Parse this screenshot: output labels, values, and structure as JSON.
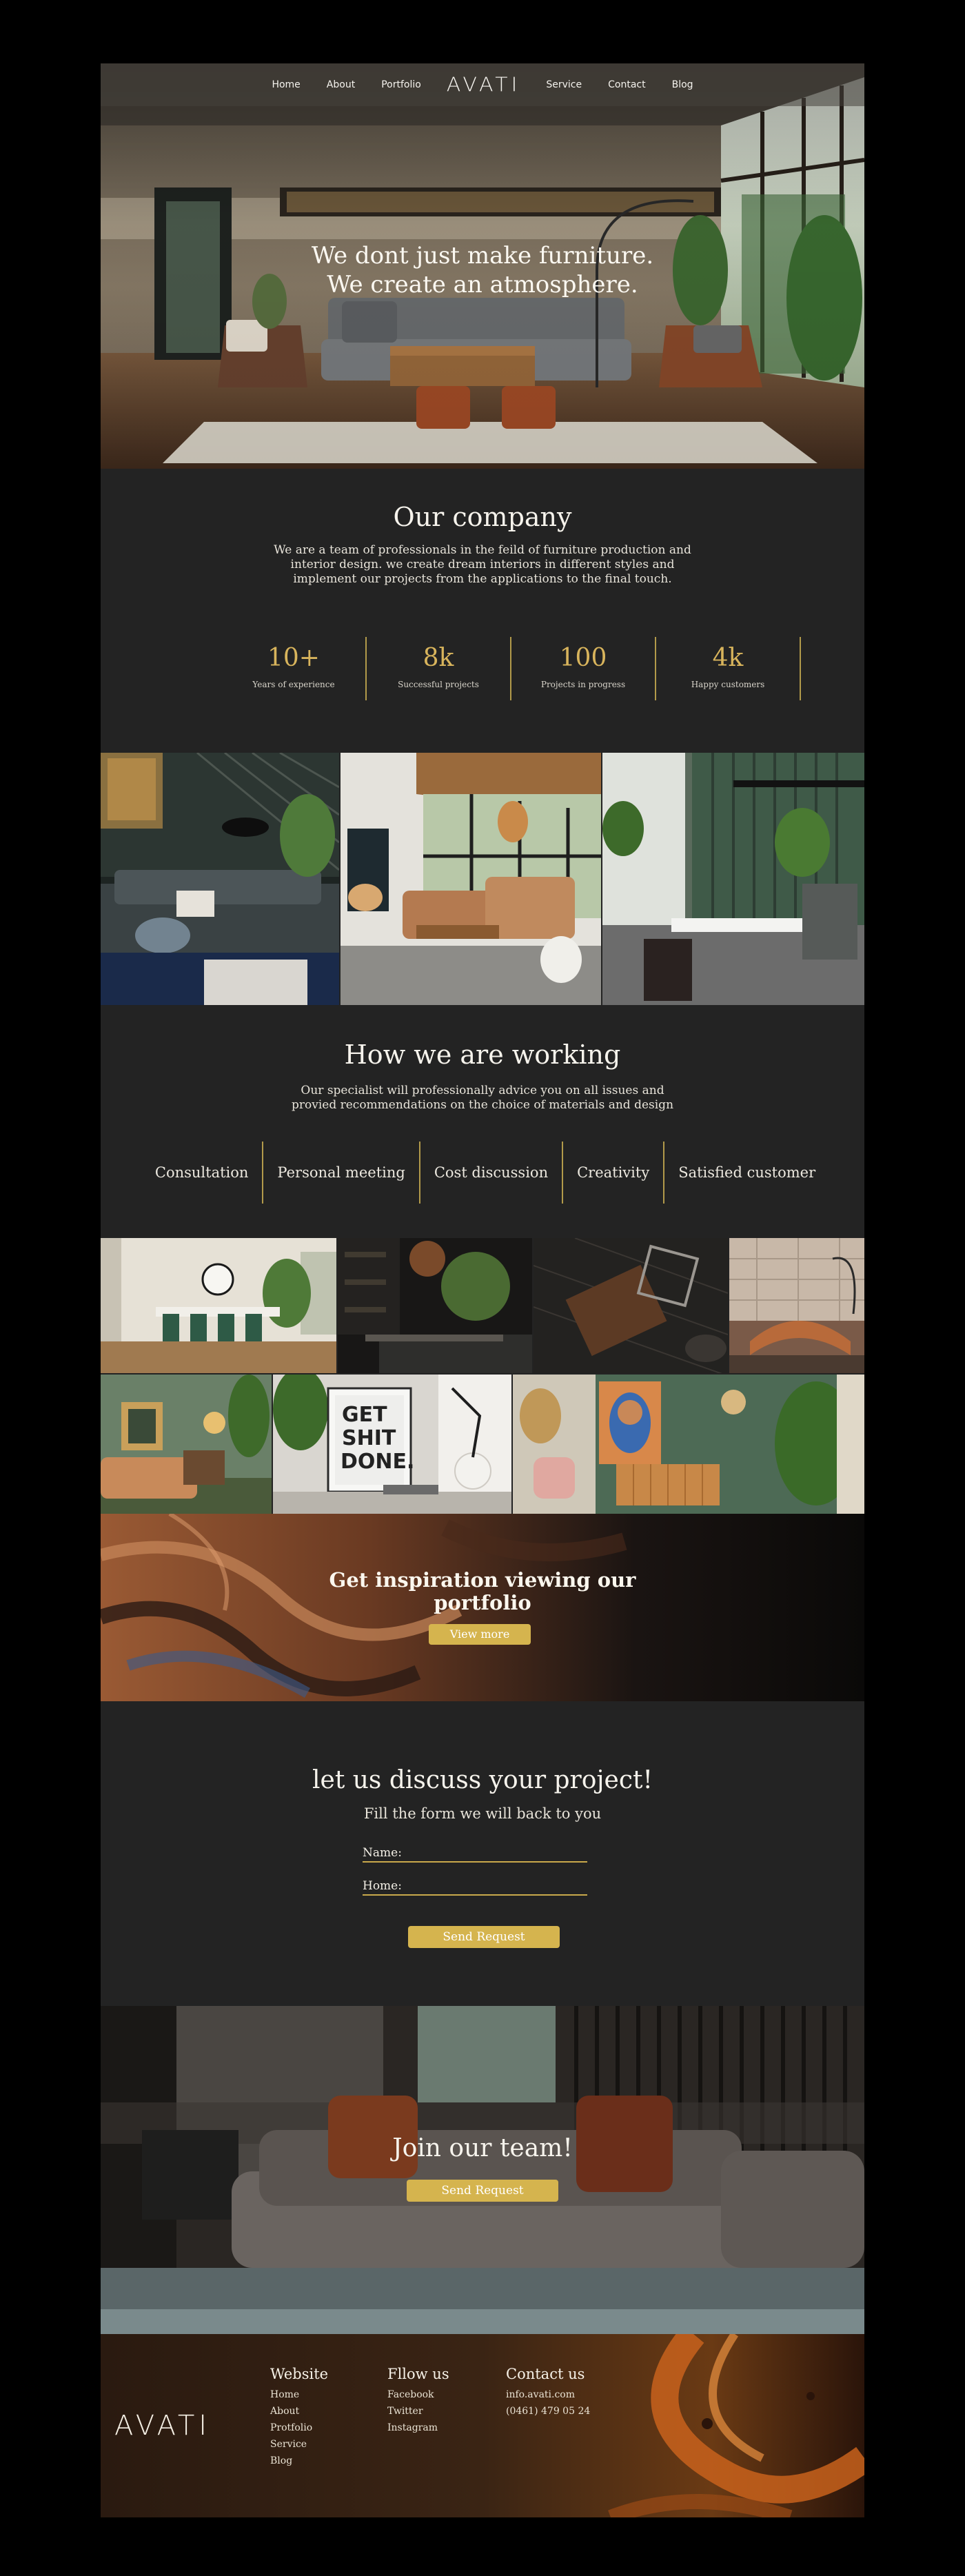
{
  "nav": {
    "left": [
      "Home",
      "About",
      "Portfolio"
    ],
    "logo": "AVATI",
    "right": [
      "Service",
      "Contact",
      "Blog"
    ]
  },
  "hero": {
    "line1": "We dont just make furniture.",
    "line2": "We create an atmosphere."
  },
  "company": {
    "title": "Our company",
    "text_line1": "We are a team of professionals in the feild of furniture production and",
    "text_line2": "interior design. we create dream interiors in different styles and",
    "text_line3": "implement our projects from the applications to the final touch.",
    "stats": [
      {
        "value": "10+",
        "label": "Years of experience"
      },
      {
        "value": "8k",
        "label": "Successful projects"
      },
      {
        "value": "100",
        "label": "Projects in progress"
      },
      {
        "value": "4k",
        "label": "Happy customers"
      }
    ]
  },
  "working": {
    "title": "How we are working",
    "text_line1": "Our specialist will professionally advice you on all issues and",
    "text_line2": "provied recommendations on the choice of materials and design",
    "steps": [
      "Consultation",
      "Personal meeting",
      "Cost discussion",
      "Creativity",
      "Satisfied customer"
    ]
  },
  "poster": {
    "line1": "GET",
    "line2": "SHIT",
    "line3": "DONE."
  },
  "inspiration": {
    "title_line1": "Get inspiration viewing our",
    "title_line2": "portfolio",
    "button": "View more"
  },
  "contact_form": {
    "title": "let us discuss your project!",
    "subtitle": "Fill the form we will back to you",
    "field1_label": "Name:",
    "field2_label": "Home:",
    "button": "Send Request"
  },
  "team": {
    "title": "Join our team!",
    "button": "Send Request"
  },
  "footer": {
    "logo": "AVATI",
    "website": {
      "heading": "Website",
      "items": [
        "Home",
        "About",
        "Protfolio",
        "Service",
        "Blog"
      ]
    },
    "follow": {
      "heading": "Fllow us",
      "items": [
        "Facebook",
        "Twitter",
        "Instagram"
      ]
    },
    "contact": {
      "heading": "Contact us",
      "items": [
        "info.avati.com",
        "(0461) 479 05 24"
      ]
    }
  },
  "colors": {
    "accent": "#d5b44e",
    "section_bg": "#232323",
    "page_bg": "#000000"
  }
}
